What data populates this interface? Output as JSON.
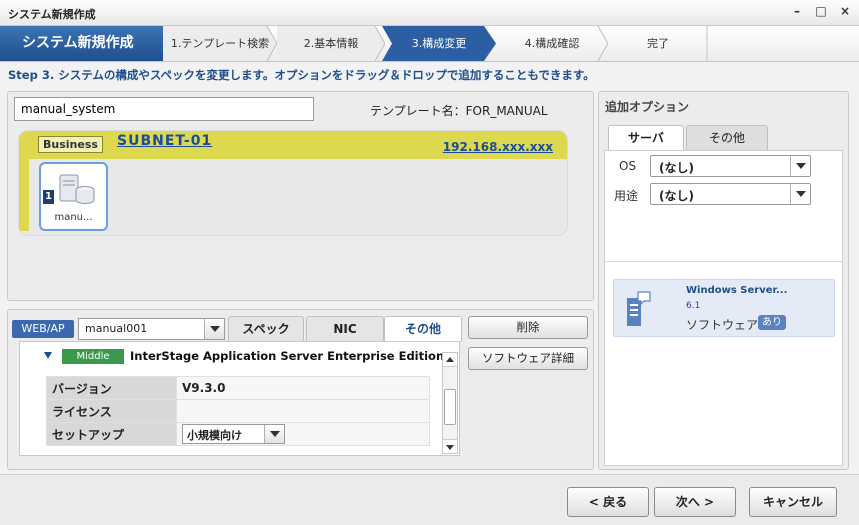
{
  "window": {
    "title": "システム新規作成"
  },
  "wizard": {
    "brand": "システム新規作成",
    "steps": [
      {
        "label": "1.テンプレート検索",
        "state": "done"
      },
      {
        "label": "2.基本情報",
        "state": "done"
      },
      {
        "label": "3.構成変更",
        "state": "active"
      },
      {
        "label": "4.構成確認",
        "state": "todo"
      },
      {
        "label": "完了",
        "state": "todo"
      }
    ]
  },
  "instruction": "Step 3. システムの構成やスペックを変更します。オプションをドラッグ＆ドロップで追加することもできます。",
  "main": {
    "system_name": "manual_system",
    "template_label": "テンプレート名：FOR_MANUAL",
    "network": {
      "badge": "Business",
      "subnet": "SUBNET-01",
      "ip": "192.168.xxx.xxx",
      "server": {
        "number": "1",
        "label": "manu..."
      }
    }
  },
  "detail": {
    "tier_tag": "WEB/AP",
    "server_select": "manual001",
    "tabs": [
      "スペック",
      "NIC",
      "その他"
    ],
    "middleware_badge": "Middle",
    "product": "InterStage Application Server Enterprise Edition",
    "rows": [
      {
        "key": "バージョン",
        "value": "V9.3.0"
      },
      {
        "key": "ライセンス",
        "value": ""
      },
      {
        "key": "セットアップ",
        "value": "小規模向け"
      }
    ],
    "delete_button": "削除",
    "software_detail_button": "ソフトウェア詳細"
  },
  "options": {
    "title": "追加オプション",
    "tabs": [
      "サーバ",
      "その他"
    ],
    "os_label": "OS",
    "os_value": "(なし)",
    "use_label": "用途",
    "use_value": "(なし)",
    "card": {
      "name": "Windows Server...",
      "version": "6.1",
      "type": "ソフトウェア",
      "badge": "あり"
    }
  },
  "footer": {
    "back": "< 戻る",
    "next": "次へ >",
    "cancel": "キャンセル"
  }
}
